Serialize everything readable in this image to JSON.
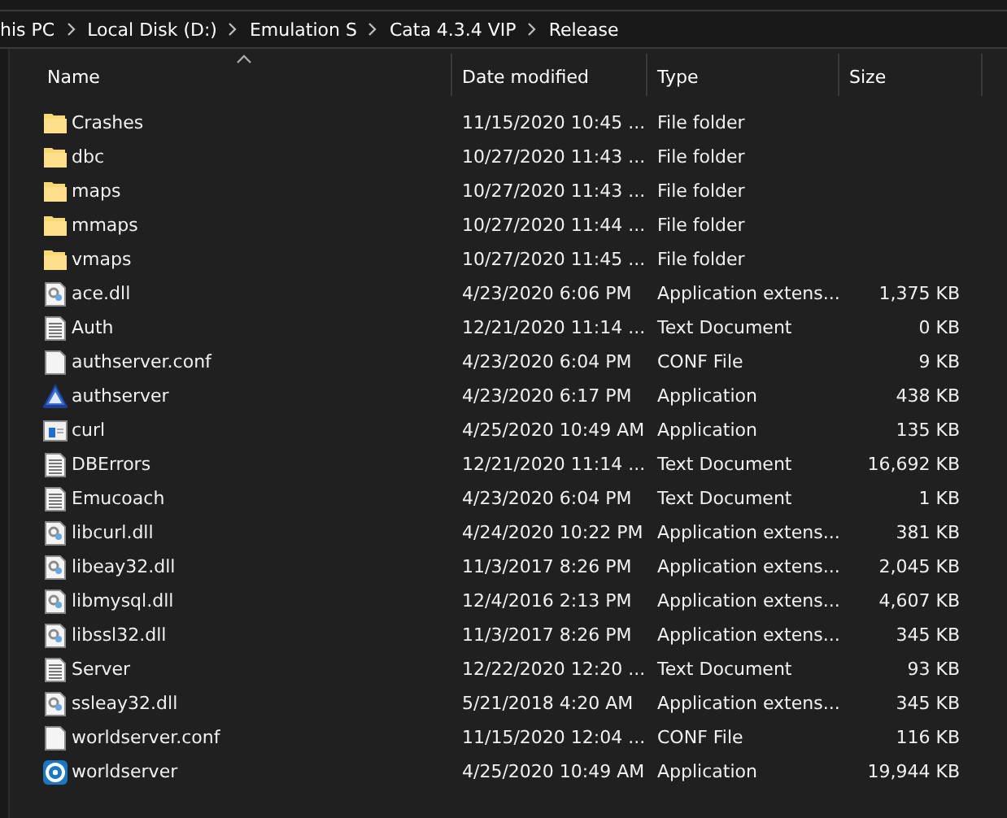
{
  "breadcrumb": [
    "his PC",
    "Local Disk (D:)",
    "Emulation S",
    "Cata 4.3.4 VIP",
    "Release"
  ],
  "columns": [
    {
      "label": "Name",
      "sorted": true
    },
    {
      "label": "Date modified",
      "sorted": false
    },
    {
      "label": "Type",
      "sorted": false
    },
    {
      "label": "Size",
      "sorted": false
    }
  ],
  "rows": [
    {
      "kind": "folder",
      "name": "Crashes",
      "date": "11/15/2020 10:45 ...",
      "type": "File folder"
    },
    {
      "kind": "folder",
      "name": "dbc",
      "date": "10/27/2020 11:43 ...",
      "type": "File folder"
    },
    {
      "kind": "folder",
      "name": "maps",
      "date": "10/27/2020 11:43 ...",
      "type": "File folder"
    },
    {
      "kind": "folder",
      "name": "mmaps",
      "date": "10/27/2020 11:44 ...",
      "type": "File folder"
    },
    {
      "kind": "folder",
      "name": "vmaps",
      "date": "10/27/2020 11:45 ...",
      "type": "File folder"
    },
    {
      "kind": "dll",
      "name": "ace.dll",
      "date": "4/23/2020 6:06 PM",
      "type": "Application extens...",
      "size": "1,375 KB"
    },
    {
      "kind": "text",
      "name": "Auth",
      "date": "12/21/2020 11:14 ...",
      "type": "Text Document",
      "size": "0 KB"
    },
    {
      "kind": "blank",
      "name": "authserver.conf",
      "date": "4/23/2020 6:04 PM",
      "type": "CONF File",
      "size": "9 KB"
    },
    {
      "kind": "triangle-app",
      "name": "authserver",
      "date": "4/23/2020 6:17 PM",
      "type": "Application",
      "size": "438 KB"
    },
    {
      "kind": "window-app",
      "name": "curl",
      "date": "4/25/2020 10:49 AM",
      "type": "Application",
      "size": "135 KB"
    },
    {
      "kind": "text",
      "name": "DBErrors",
      "date": "12/21/2020 11:14 ...",
      "type": "Text Document",
      "size": "16,692 KB"
    },
    {
      "kind": "text",
      "name": "Emucoach",
      "date": "4/23/2020 6:04 PM",
      "type": "Text Document",
      "size": "1 KB"
    },
    {
      "kind": "dll",
      "name": "libcurl.dll",
      "date": "4/24/2020 10:22 PM",
      "type": "Application extens...",
      "size": "381 KB"
    },
    {
      "kind": "dll",
      "name": "libeay32.dll",
      "date": "11/3/2017 8:26 PM",
      "type": "Application extens...",
      "size": "2,045 KB"
    },
    {
      "kind": "dll",
      "name": "libmysql.dll",
      "date": "12/4/2016 2:13 PM",
      "type": "Application extens...",
      "size": "4,607 KB"
    },
    {
      "kind": "dll",
      "name": "libssl32.dll",
      "date": "11/3/2017 8:26 PM",
      "type": "Application extens...",
      "size": "345 KB"
    },
    {
      "kind": "text",
      "name": "Server",
      "date": "12/22/2020 12:20 ...",
      "type": "Text Document",
      "size": "93 KB"
    },
    {
      "kind": "dll",
      "name": "ssleay32.dll",
      "date": "5/21/2018 4:20 AM",
      "type": "Application extens...",
      "size": "345 KB"
    },
    {
      "kind": "blank",
      "name": "worldserver.conf",
      "date": "11/15/2020 12:04 ...",
      "type": "CONF File",
      "size": "116 KB"
    },
    {
      "kind": "ring-app",
      "name": "worldserver",
      "date": "4/25/2020 10:49 AM",
      "type": "Application",
      "size": "19,944 KB"
    }
  ]
}
